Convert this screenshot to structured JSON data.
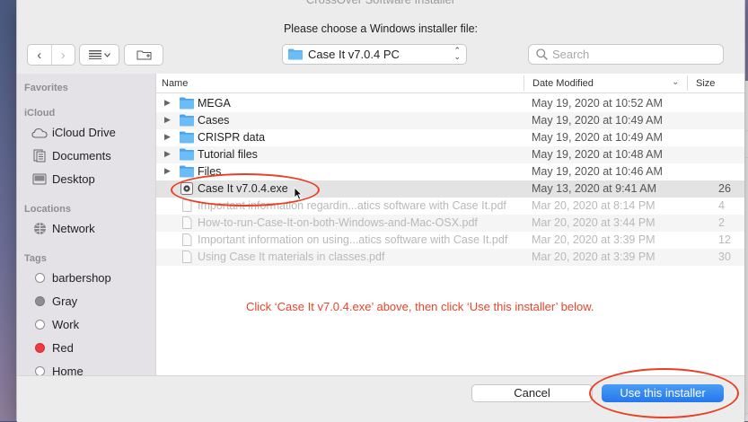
{
  "window_title": "CrossOver Software Installer",
  "prompt": "Please choose a Windows installer file:",
  "toolbar": {
    "back_glyph": "‹",
    "forward_glyph": "›",
    "view_icon": "list-view-icon",
    "new_folder_icon": "new-folder-icon"
  },
  "location": {
    "label": "Case It v7.0.4 PC"
  },
  "search": {
    "placeholder": "Search"
  },
  "sidebar": {
    "favorites_header": "Favorites",
    "icloud_header": "iCloud",
    "icloud_items": [
      {
        "label": "iCloud Drive",
        "icon": "cloud-icon"
      },
      {
        "label": "Documents",
        "icon": "document-icon"
      },
      {
        "label": "Desktop",
        "icon": "desktop-icon"
      }
    ],
    "locations_header": "Locations",
    "locations_items": [
      {
        "label": "Network",
        "icon": "globe-icon"
      }
    ],
    "tags_header": "Tags",
    "tags": [
      {
        "label": "barbershop",
        "color": "#ffffff"
      },
      {
        "label": "Gray",
        "color": "#8e8e8e"
      },
      {
        "label": "Work",
        "color": "#ffffff"
      },
      {
        "label": "Red",
        "color": "#ee3b3f"
      },
      {
        "label": "Home",
        "color": "#ffffff"
      }
    ]
  },
  "columns": {
    "name": "Name",
    "date": "Date Modified",
    "size": "Size"
  },
  "files": [
    {
      "name": "MEGA",
      "date": "May 19, 2020 at 10:52 AM",
      "size": "",
      "kind": "folder"
    },
    {
      "name": "Cases",
      "date": "May 19, 2020 at 10:49 AM",
      "size": "",
      "kind": "folder"
    },
    {
      "name": "CRISPR data",
      "date": "May 19, 2020 at 10:49 AM",
      "size": "",
      "kind": "folder"
    },
    {
      "name": "Tutorial files",
      "date": "May 19, 2020 at 10:48 AM",
      "size": "",
      "kind": "folder"
    },
    {
      "name": "Files",
      "date": "May 19, 2020 at 10:46 AM",
      "size": "",
      "kind": "folder"
    },
    {
      "name": "Case It v7.0.4.exe",
      "date": "May 13, 2020 at 9:41 AM",
      "size": "26",
      "kind": "exe"
    },
    {
      "name": "Important information regardin...atics software with Case It.pdf",
      "date": "Mar 20, 2020 at 8:14 PM",
      "size": "4",
      "kind": "pdf"
    },
    {
      "name": "How-to-run-Case-It-on-both-Windows-and-Mac-OSX.pdf",
      "date": "Mar 20, 2020 at 3:44 PM",
      "size": "2",
      "kind": "pdf"
    },
    {
      "name": "Important information on using...atics software with Case It.pdf",
      "date": "Mar 20, 2020 at 3:39 PM",
      "size": "12",
      "kind": "pdf"
    },
    {
      "name": "Using Case It materials in classes.pdf",
      "date": "Mar 20, 2020 at 3:39 PM",
      "size": "30",
      "kind": "pdf"
    }
  ],
  "instruction": "Click ‘Case It v7.0.4.exe’ above, then click ‘Use this installer’ below.",
  "buttons": {
    "cancel": "Cancel",
    "use": "Use this installer"
  },
  "background_fragment": "Se",
  "colors": {
    "accent": "#2478ee",
    "annotation": "#e8442a",
    "folder": "#57aef3"
  }
}
